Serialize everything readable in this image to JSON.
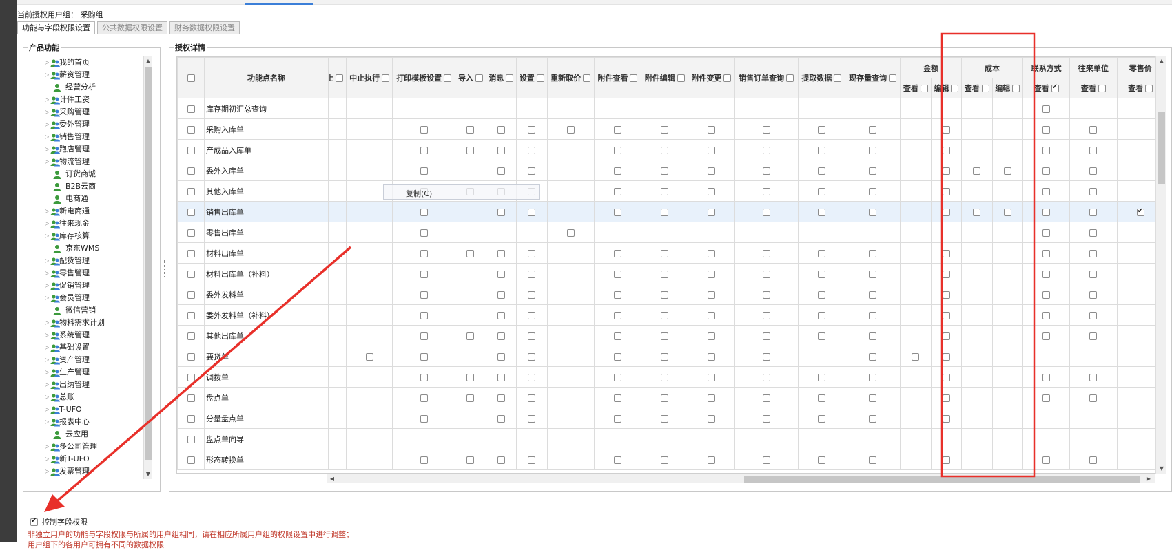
{
  "header": {
    "usergroup_label": "当前授权用户组：",
    "usergroup_value": "采购组"
  },
  "tabs": [
    "功能与字段权限设置",
    "公共数据权限设置",
    "财务数据权限设置"
  ],
  "product_panel": {
    "title": "产品功能",
    "items": [
      {
        "label": "我的首页",
        "type": "group"
      },
      {
        "label": "薪资管理",
        "type": "group"
      },
      {
        "label": "经营分析",
        "type": "leaf"
      },
      {
        "label": "计件工资",
        "type": "group"
      },
      {
        "label": "采购管理",
        "type": "group"
      },
      {
        "label": "委外管理",
        "type": "group"
      },
      {
        "label": "销售管理",
        "type": "group"
      },
      {
        "label": "跑店管理",
        "type": "group"
      },
      {
        "label": "物流管理",
        "type": "group"
      },
      {
        "label": "订货商城",
        "type": "leaf"
      },
      {
        "label": "B2B云商",
        "type": "leaf"
      },
      {
        "label": "电商通",
        "type": "leaf"
      },
      {
        "label": "新电商通",
        "type": "group"
      },
      {
        "label": "往来现金",
        "type": "group"
      },
      {
        "label": "库存核算",
        "type": "group"
      },
      {
        "label": "京东WMS",
        "type": "leaf"
      },
      {
        "label": "配货管理",
        "type": "group"
      },
      {
        "label": "零售管理",
        "type": "group"
      },
      {
        "label": "促销管理",
        "type": "group"
      },
      {
        "label": "会员管理",
        "type": "group"
      },
      {
        "label": "微信营销",
        "type": "leaf"
      },
      {
        "label": "物料需求计划",
        "type": "group"
      },
      {
        "label": "系统管理",
        "type": "group"
      },
      {
        "label": "基础设置",
        "type": "group"
      },
      {
        "label": "资产管理",
        "type": "group"
      },
      {
        "label": "生产管理",
        "type": "group"
      },
      {
        "label": "出纳管理",
        "type": "group"
      },
      {
        "label": "总账",
        "type": "group"
      },
      {
        "label": "T-UFO",
        "type": "group"
      },
      {
        "label": "报表中心",
        "type": "group"
      },
      {
        "label": "云应用",
        "type": "leaf"
      },
      {
        "label": "多公司管理",
        "type": "group"
      },
      {
        "label": "新T-UFO",
        "type": "group"
      },
      {
        "label": "发票管理",
        "type": "group"
      }
    ]
  },
  "auth_panel": {
    "title": "授权详情",
    "name_header": "功能点名称",
    "clipped_header": "止",
    "single_headers": [
      "中止执行",
      "打印模板设置",
      "导入",
      "消息",
      "设置",
      "重新取价",
      "附件查看",
      "附件编辑",
      "附件变更",
      "销售订单查询",
      "提取数据",
      "现存量查询"
    ],
    "group_headers": [
      {
        "label": "金额",
        "subs": [
          "查看",
          "编辑"
        ]
      },
      {
        "label": "成本",
        "subs": [
          "查看",
          "编辑"
        ]
      },
      {
        "label": "联系方式",
        "subs": [
          "查看"
        ]
      },
      {
        "label": "往来单位",
        "subs": [
          "查看"
        ]
      },
      {
        "label": "零售价",
        "subs": [
          "查看"
        ]
      }
    ],
    "header_checks": {
      "联系方式-查看": true
    },
    "rows": [
      {
        "name": "库存期初汇总查询",
        "cells": "000000000000000000100000"
      },
      {
        "name": "采购入库单",
        "cells": "000111111111110100110000"
      },
      {
        "name": "产成品入库单",
        "cells": "000111101111110100110000"
      },
      {
        "name": "委外入库单",
        "cells": "000101101111110111110000"
      },
      {
        "name": "其他入库单",
        "cells": "000111101111110100110000"
      },
      {
        "name": "销售出库单",
        "cells": "000101101111110111112001"
      },
      {
        "name": "零售出库单",
        "cells": "000100010000000000110000"
      },
      {
        "name": "材料出库单",
        "cells": "000111101111110100110000"
      },
      {
        "name": "材料出库单（补料）",
        "cells": "000101101111110100110000"
      },
      {
        "name": "委外发料单",
        "cells": "000101101111110100110000"
      },
      {
        "name": "委外发料单（补料）",
        "cells": "000101101111110100110000"
      },
      {
        "name": "其他出库单",
        "cells": "000111101111110100110000"
      },
      {
        "name": "要货单",
        "cells": "001101101111011100000000"
      },
      {
        "name": "调拨单",
        "cells": "000111101111110100110000"
      },
      {
        "name": "盘点单",
        "cells": "000111101111110100110000"
      },
      {
        "name": "分量盘点单",
        "cells": "000101101111110100000000"
      },
      {
        "name": "盘点单向导",
        "cells": "000000000000000000000000"
      },
      {
        "name": "形态转换单",
        "cells": "000111101111110100110000"
      }
    ],
    "selected_row": 5
  },
  "context_menu": {
    "item": "复制(C)"
  },
  "footer": {
    "checkbox_label": "控制字段权限",
    "checkbox_checked": true,
    "notice_line1": "非独立用户的功能与字段权限与所属的用户组相同，请在相应所属用户组的权限设置中进行调整；",
    "notice_line2": "用户组下的各用户可拥有不同的数据权限"
  },
  "annotations": {
    "highlight_color": "#e8302a"
  }
}
